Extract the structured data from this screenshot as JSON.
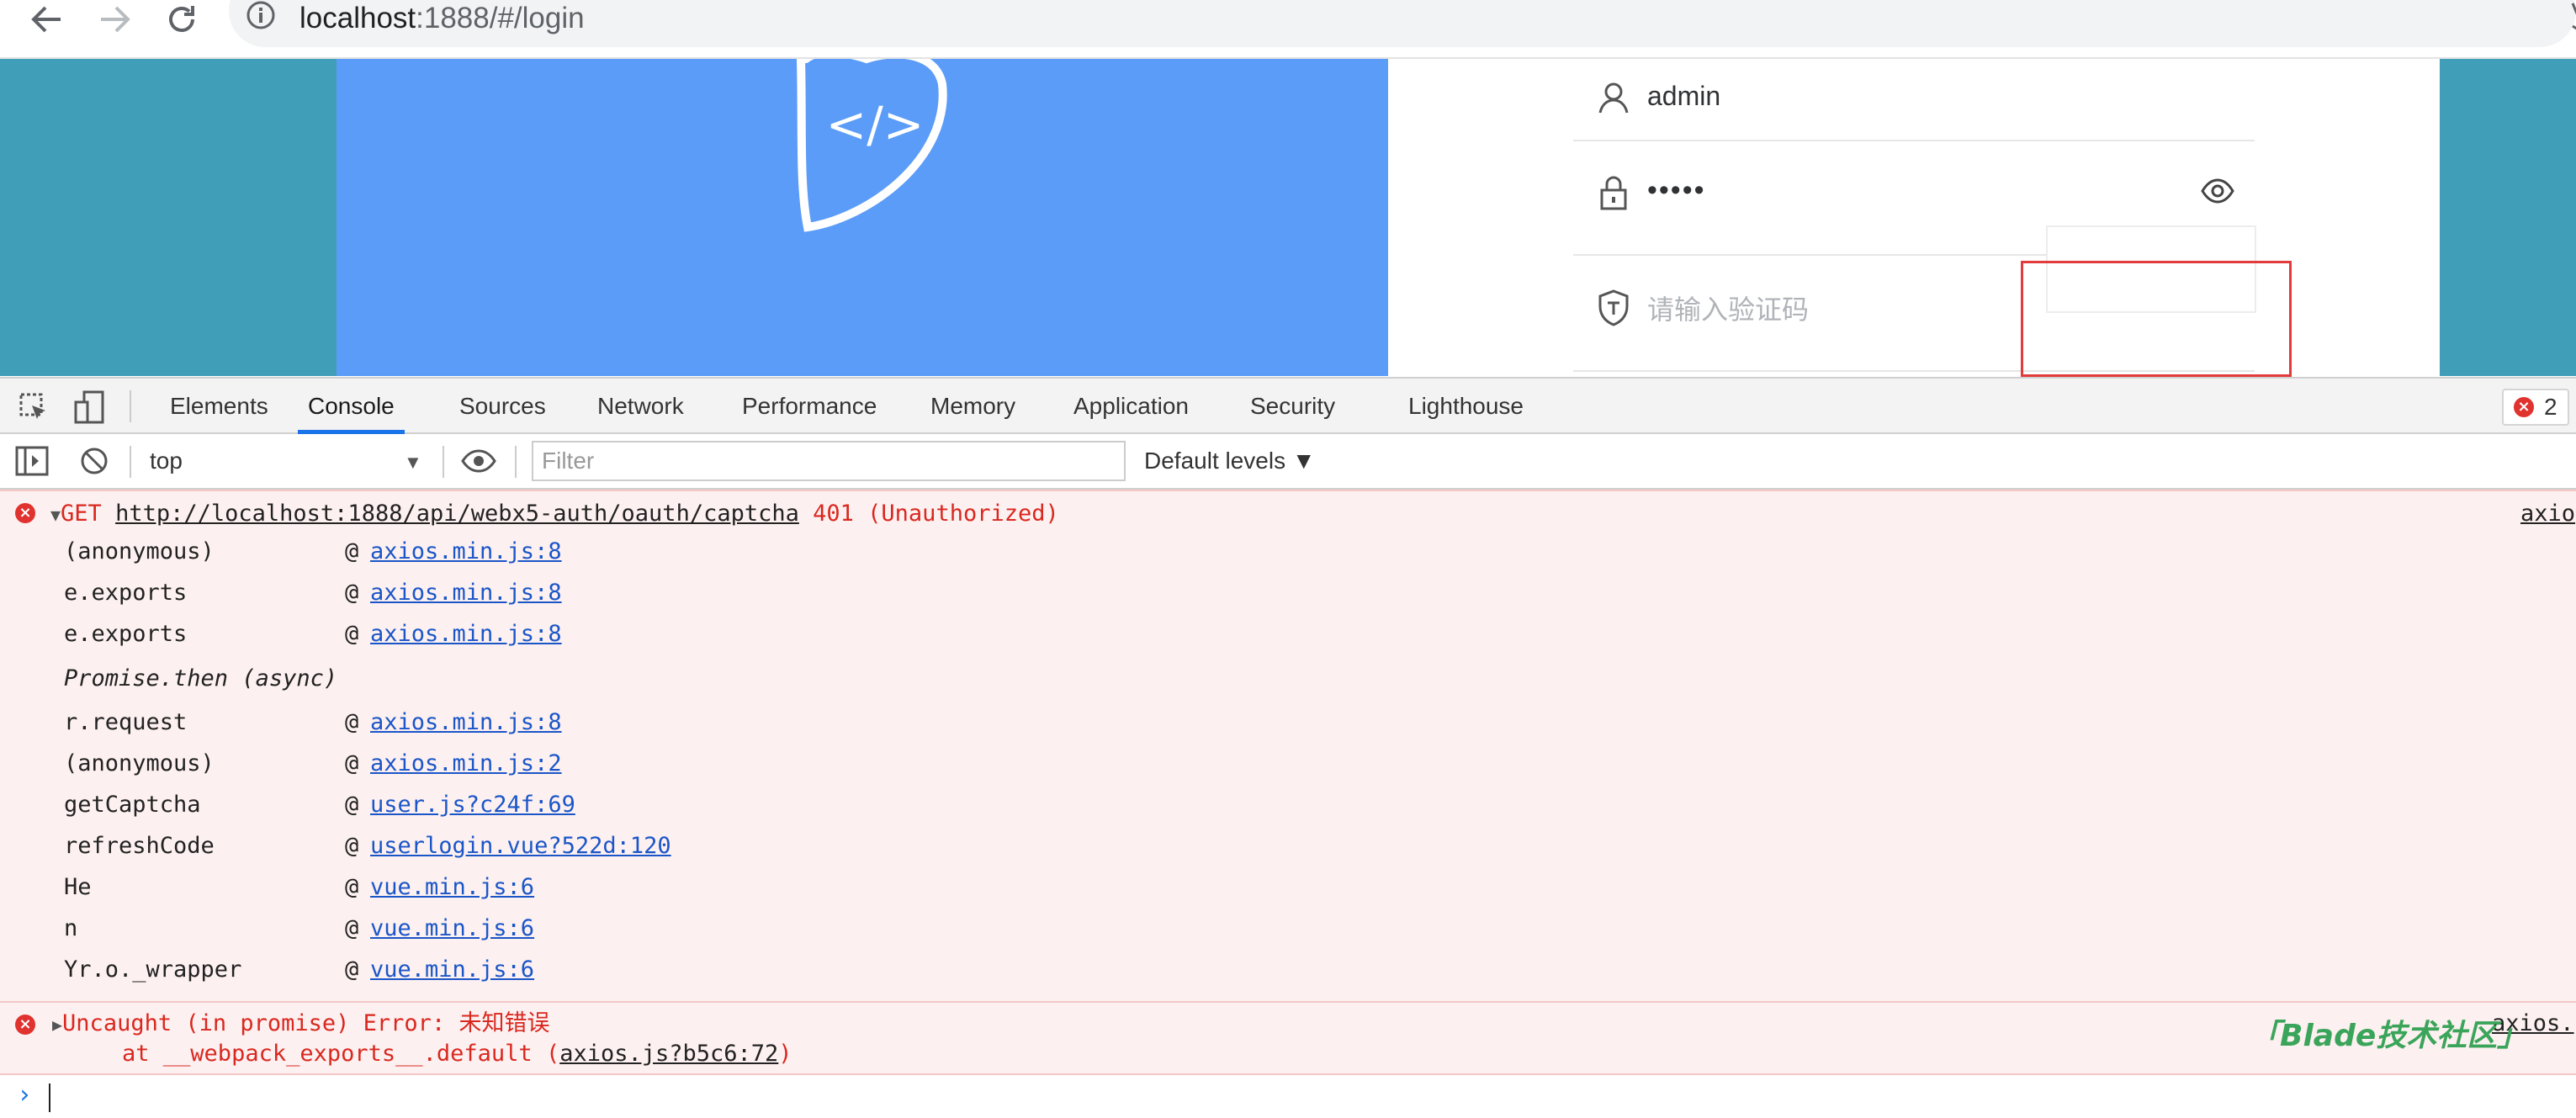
{
  "browser": {
    "url_host": "localhost",
    "url_path": ":1888/#/login"
  },
  "login": {
    "username": "admin",
    "password_mask": "•••••",
    "captcha_placeholder": "请输入验证码",
    "logo_text": "</>"
  },
  "devtools": {
    "tabs": [
      "Elements",
      "Console",
      "Sources",
      "Network",
      "Performance",
      "Memory",
      "Application",
      "Security",
      "Lighthouse"
    ],
    "active_tab": "Console",
    "error_count": "2",
    "context": "top",
    "filter_placeholder": "Filter",
    "levels": "Default levels ▼"
  },
  "console": {
    "error1": {
      "method": "GET",
      "url": "http://localhost:1888/api/webx5-auth/oauth/captcha",
      "status": "401 (Unauthorized)",
      "source": "axio",
      "frames": [
        {
          "fn": "(anonymous)",
          "at": "@",
          "link": "axios.min.js:8"
        },
        {
          "fn": "e.exports",
          "at": "@",
          "link": "axios.min.js:8"
        },
        {
          "fn": "e.exports",
          "at": "@",
          "link": "axios.min.js:8"
        },
        {
          "fn": "Promise.then (async)",
          "at": "",
          "link": ""
        },
        {
          "fn": "r.request",
          "at": "@",
          "link": "axios.min.js:8"
        },
        {
          "fn": "(anonymous)",
          "at": "@",
          "link": "axios.min.js:2"
        },
        {
          "fn": "getCaptcha",
          "at": "@",
          "link": "user.js?c24f:69"
        },
        {
          "fn": "refreshCode",
          "at": "@",
          "link": "userlogin.vue?522d:120"
        },
        {
          "fn": "He",
          "at": "@",
          "link": "vue.min.js:6"
        },
        {
          "fn": "n",
          "at": "@",
          "link": "vue.min.js:6"
        },
        {
          "fn": "Yr.o._wrapper",
          "at": "@",
          "link": "vue.min.js:6"
        }
      ]
    },
    "error2": {
      "line1": "Uncaught (in promise) Error: 未知错误",
      "line2_prefix": "    at __webpack_exports__.default (",
      "line2_link": "axios.js?b5c6:72",
      "line2_suffix": ")",
      "source": "axios."
    },
    "watermark": "「Blade技术社区」"
  }
}
